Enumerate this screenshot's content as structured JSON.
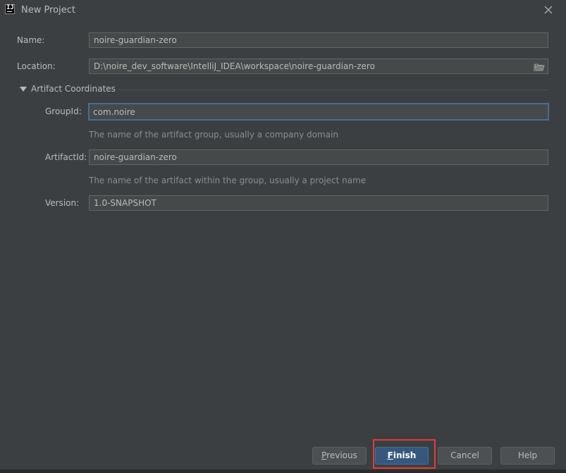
{
  "window": {
    "title": "New Project",
    "app_icon_text": "IJ",
    "icon": "intellij-icon",
    "close_icon": "close-icon"
  },
  "form": {
    "name_label": "Name:",
    "name_value": "noire-guardian-zero",
    "location_label": "Location:",
    "location_value": "D:\\noire_dev_software\\IntelliJ_IDEA\\workspace\\noire-guardian-zero",
    "browse_icon": "folder-icon"
  },
  "artifact": {
    "section_title": "Artifact Coordinates",
    "group_id_label": "GroupId:",
    "group_id_value": "com.noire",
    "group_id_hint": "The name of the artifact group, usually a company domain",
    "artifact_id_label": "ArtifactId:",
    "artifact_id_value": "noire-guardian-zero",
    "artifact_id_hint": "The name of the artifact within the group, usually a project name",
    "version_label": "Version:",
    "version_value": "1.0-SNAPSHOT"
  },
  "buttons": {
    "previous_mnemonic": "P",
    "previous_rest": "revious",
    "finish_mnemonic": "F",
    "finish_rest": "inish",
    "cancel": "Cancel",
    "help": "Help"
  },
  "colors": {
    "background": "#3c3f41",
    "field_background": "#45494a",
    "focus_border": "#466d94",
    "primary_button": "#365880",
    "highlight": "#e23b3b"
  }
}
